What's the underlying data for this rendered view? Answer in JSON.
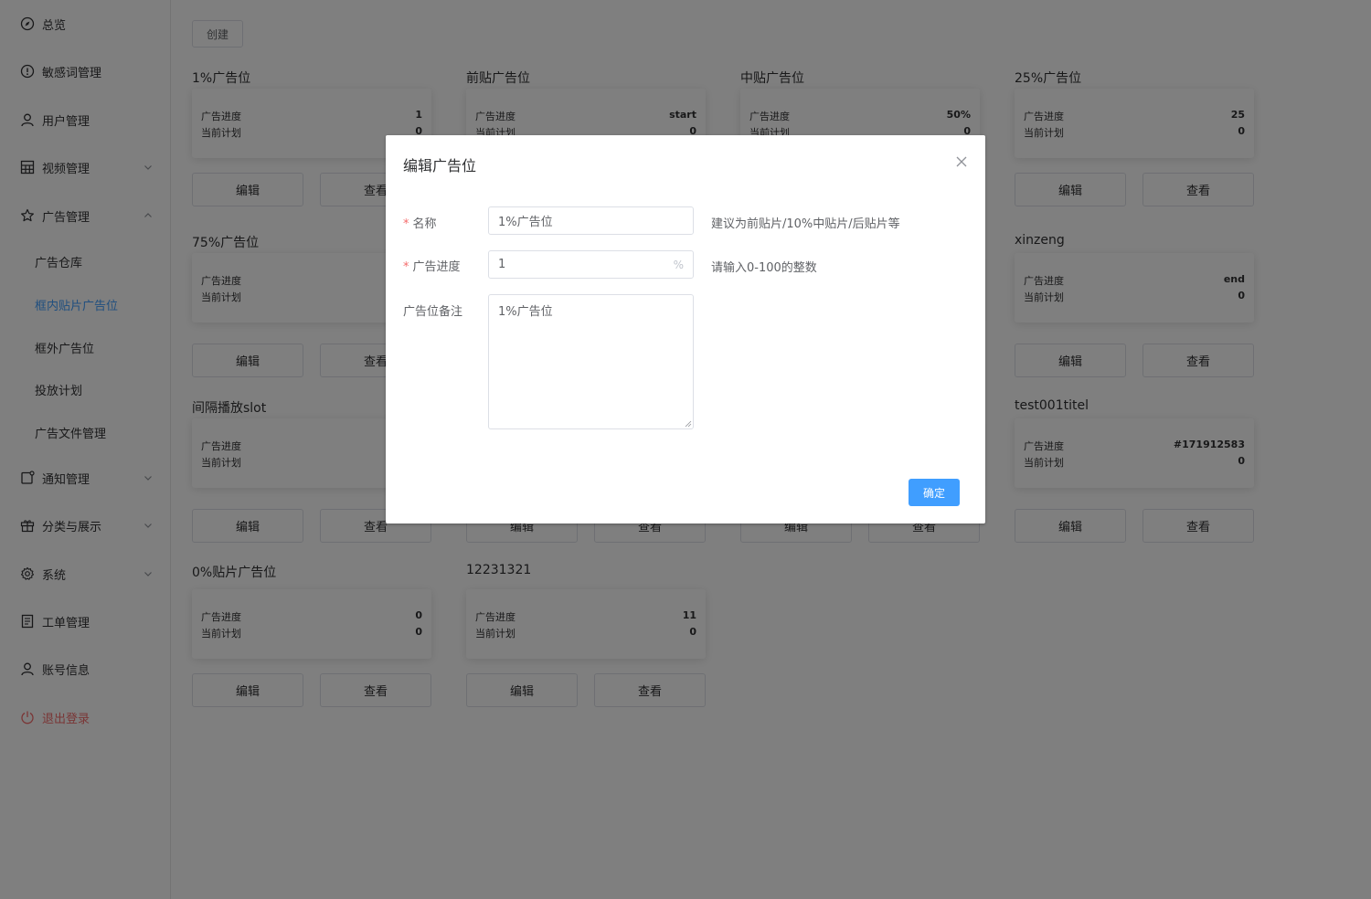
{
  "sidebar": {
    "items": [
      {
        "label": "总览",
        "icon": "compass-icon"
      },
      {
        "label": "敏感词管理",
        "icon": "warning-circle-icon"
      },
      {
        "label": "用户管理",
        "icon": "user-icon"
      },
      {
        "label": "视频管理",
        "icon": "grid-icon"
      },
      {
        "label": "广告管理",
        "icon": "star-icon"
      },
      {
        "label": "通知管理",
        "icon": "notice-icon"
      },
      {
        "label": "分类与展示",
        "icon": "present-icon"
      },
      {
        "label": "系统",
        "icon": "gear-icon"
      },
      {
        "label": "工单管理",
        "icon": "document-icon"
      },
      {
        "label": "账号信息",
        "icon": "user-icon"
      },
      {
        "label": "退出登录",
        "icon": "power-icon"
      }
    ],
    "ad_submenu": [
      "广告仓库",
      "框内贴片广告位",
      "框外广告位",
      "投放计划",
      "广告文件管理"
    ]
  },
  "main": {
    "create_label": "创建",
    "progress_label": "广告进度",
    "plan_label": "当前计划",
    "edit_label": "编辑",
    "view_label": "查看",
    "slots": [
      {
        "title": "1%广告位",
        "progress": "1",
        "plan": "0"
      },
      {
        "title": "前贴广告位",
        "progress": "start",
        "plan": "0"
      },
      {
        "title": "中贴广告位",
        "progress": "50%",
        "plan": "0"
      },
      {
        "title": "25%广告位",
        "progress": "25",
        "plan": "0"
      },
      {
        "title": "75%广告位",
        "progress": "",
        "plan": ""
      },
      {
        "title": "",
        "progress": "",
        "plan": ""
      },
      {
        "title": "",
        "progress": "",
        "plan": ""
      },
      {
        "title": "xinzeng",
        "progress": "end",
        "plan": "0"
      },
      {
        "title": "间隔播放slot",
        "progress": "",
        "plan": ""
      },
      {
        "title": "",
        "progress": "",
        "plan": ""
      },
      {
        "title": "",
        "progress": "",
        "plan": ""
      },
      {
        "title": "test001titel",
        "progress": "#171912583",
        "plan": "0"
      },
      {
        "title": "0%贴片广告位",
        "progress": "0",
        "plan": "0"
      },
      {
        "title": "12231321",
        "progress": "11",
        "plan": "0"
      }
    ]
  },
  "dialog": {
    "title": "编辑广告位",
    "name_label": "名称",
    "name_value": "1%广告位",
    "name_hint": "建议为前贴片/10%中贴片/后贴片等",
    "progress_label": "广告进度",
    "progress_value": "1",
    "progress_suffix": "%",
    "progress_hint": "请输入0-100的整数",
    "note_label": "广告位备注",
    "note_value": "1%广告位",
    "confirm_label": "确定"
  },
  "colors": {
    "primary": "#409eff",
    "danger": "#f56c6c"
  }
}
